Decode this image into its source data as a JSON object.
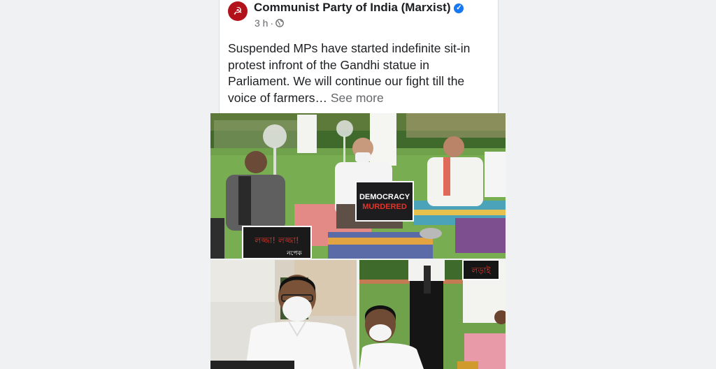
{
  "post": {
    "page_name": "Communist Party of India (Marxist)",
    "avatar_glyph": "☭",
    "verified_glyph": "✓",
    "time": "3 h",
    "separator": "·",
    "audience_icon": "globe-icon",
    "text": "Suspended MPs have started indefinite sit-in protest infront of the Gandhi statue in Parliament. We will continue our fight till the voice of farmers…",
    "see_more": "See more"
  },
  "photos": {
    "main": {
      "placard": [
        "DEMOCRACY",
        "MURDERED"
      ],
      "front_placard": "লজ্জা! লজ্জা!",
      "front_placard_sub": "নপেক"
    },
    "right": {
      "placard": "লড়াই"
    }
  },
  "colors": {
    "accent": "#1877f2",
    "brand": "#b3121b"
  }
}
